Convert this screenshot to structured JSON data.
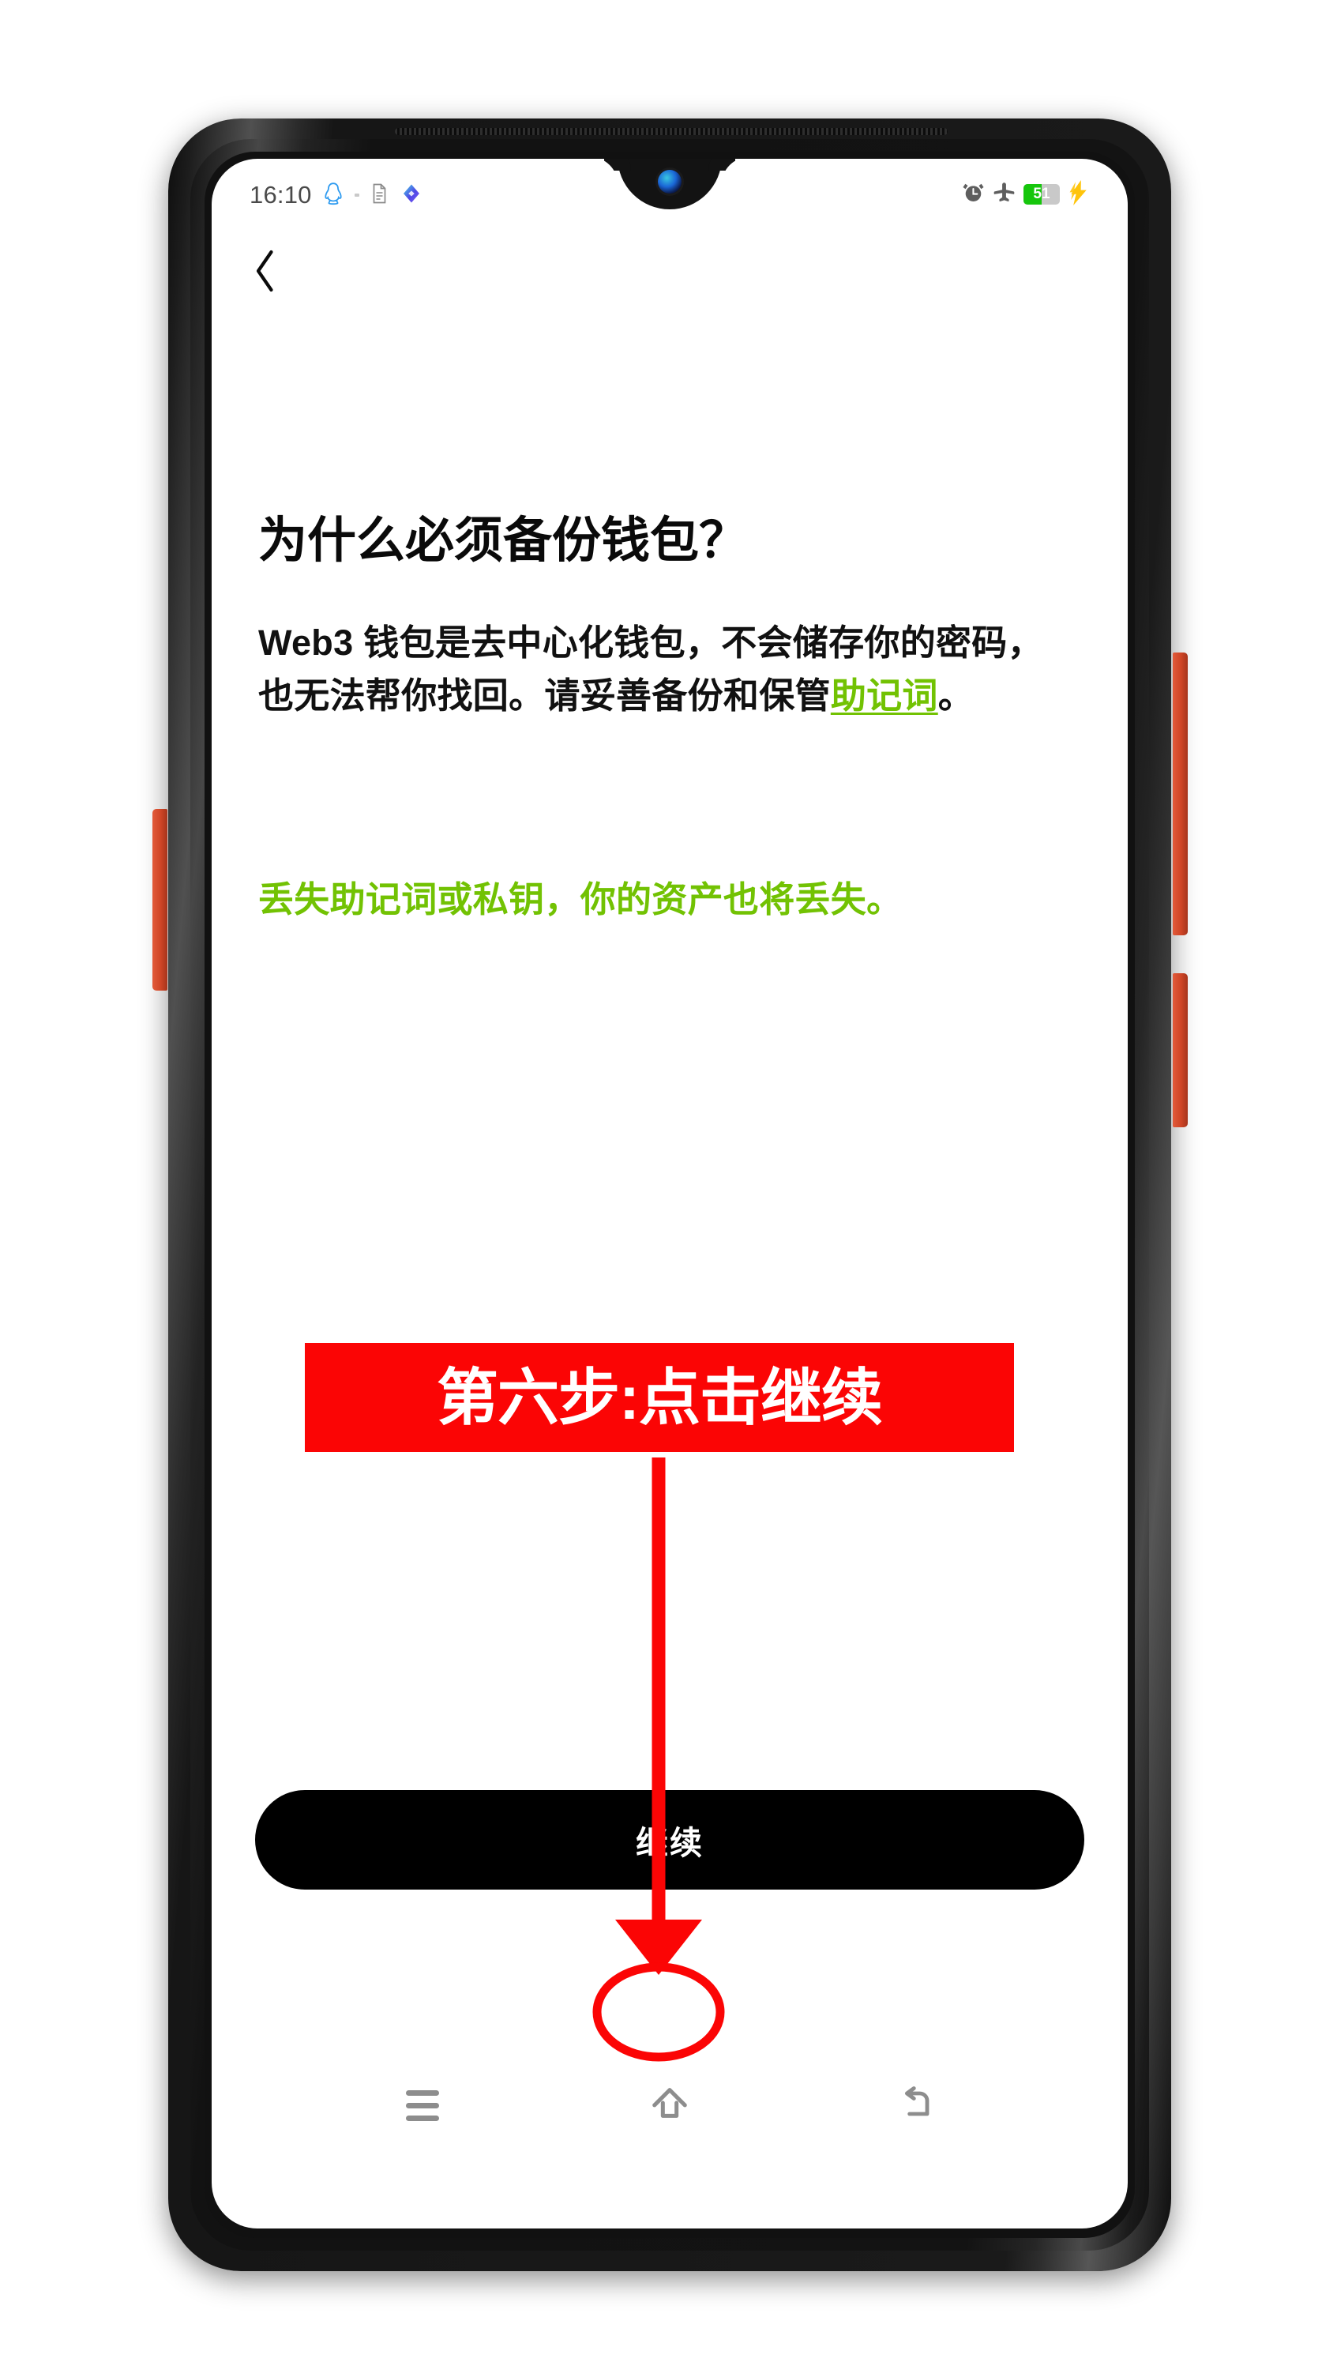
{
  "device": {
    "frame_color": "#1a1a1a",
    "side_button_color": "#cf4526"
  },
  "status_bar": {
    "time": "16:10",
    "left_icons": [
      {
        "name": "qq-penguin-icon",
        "color": "#2e9bf0"
      },
      {
        "name": "separator-dot-icon",
        "color": "#c9c9c9"
      },
      {
        "name": "document-copy-icon",
        "color": "#8a8a8a"
      },
      {
        "name": "blue-diamond-icon",
        "color": "#5b4df0"
      }
    ],
    "right_icons": [
      {
        "name": "alarm-clock-icon",
        "color": "#5e5e5e"
      },
      {
        "name": "airplane-mode-icon",
        "color": "#5e5e5e"
      },
      {
        "name": "lightning-bolt-icon",
        "color": "#ffc40a"
      }
    ],
    "battery": {
      "level_text": "51",
      "percent": 51,
      "fill_color": "#16c60c",
      "track_color": "#c9c9c9"
    }
  },
  "app": {
    "back_icon": "chevron-left-icon",
    "heading": "为什么必须备份钱包？",
    "body": {
      "before_link": "Web3 钱包是去中心化钱包，不会储存你的密码，也无法帮你找回。请妥善备份和保管",
      "link_text": "助记词",
      "after_link": "。",
      "link_color": "#72c203"
    },
    "warning": {
      "text": "丢失助记词或私钥，你的资产也将丢失。",
      "color": "#72c203"
    },
    "primary_button": {
      "label": "继续",
      "background": "#000000",
      "text_color": "#ffffff"
    }
  },
  "nav_bar": {
    "items": [
      {
        "name": "recents-button",
        "icon": "hamburger-menu-icon"
      },
      {
        "name": "home-button",
        "icon": "home-icon"
      },
      {
        "name": "back-button",
        "icon": "back-arrow-icon"
      }
    ],
    "icon_color": "#8d8d8d"
  },
  "annotation": {
    "banner_text": "第六步:点击继续",
    "banner_background": "#fb0505",
    "banner_text_color": "#ffffff",
    "arrow_color": "#fb0505",
    "highlight_ellipse_color": "#fb0505"
  }
}
